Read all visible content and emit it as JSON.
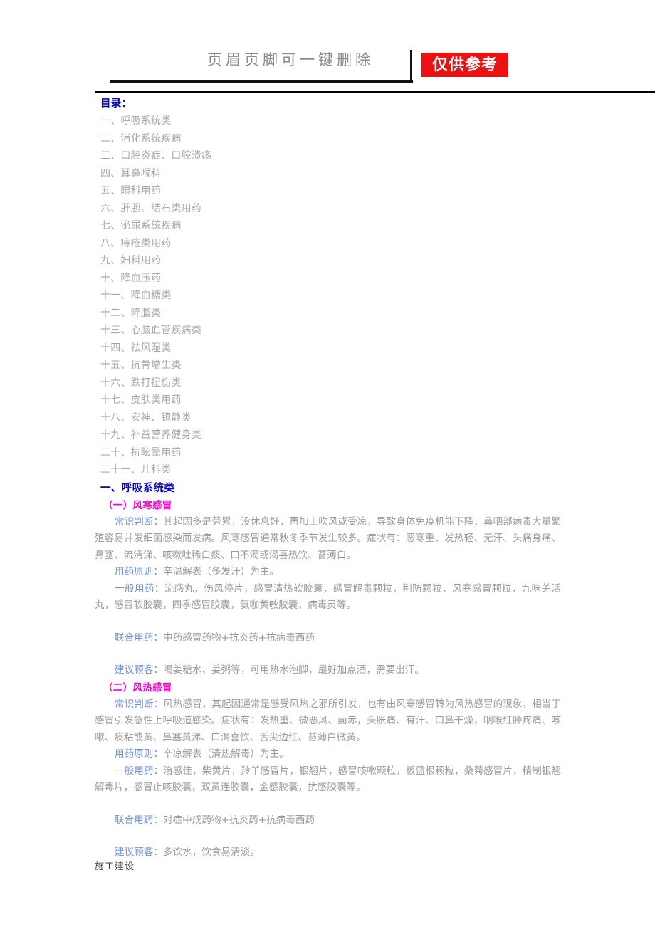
{
  "header": {
    "watermark_text": "页眉页脚可一键删除",
    "badge_text": "仅供参考",
    "badge_color": "#ee1111"
  },
  "toc": {
    "title": "目录：",
    "items": [
      "一、呼吸系统类",
      "二、消化系统疾病",
      "三、口腔炎症、口腔溃疡",
      "四、耳鼻喉科",
      "五、眼科用药",
      "六、肝胆、结石类用药",
      "七、泌尿系统疾病",
      "八、痔疮类用药",
      "九、妇科用药",
      "十、降血压药",
      "十一、降血糖类",
      "十二、降脂类",
      "十三、心脑血管疾病类",
      "十四、祛风湿类",
      "十五、抗骨增生类",
      "十六、跌打扭伤类",
      "十七、皮肤类用药",
      "十八、安神、镇静类",
      "十九、补益营养健身类",
      "二十、抗眩晕用药",
      "二十一、儿科类"
    ]
  },
  "section": {
    "title": "一、呼吸系统类",
    "title_color": "#0000cc",
    "subsections": [
      {
        "title": "（一）风寒感冒",
        "title_color": "#ff00cc",
        "paragraphs": [
          {
            "label": "常识判断：",
            "text": "其起因多是劳累，没休息好，再加上吹风或受凉，导致身体免疫机能下降，鼻咽部病毒大量繁殖容易并发细菌感染而发病。风寒感冒通常秋冬季节发生较多。症状有：恶寒重、发热轻、无汗、头痛身痛、鼻塞、流清涕、咳嗽吐稀白痰、口不渴或渴喜热饮、苔薄白。",
            "gap": false
          },
          {
            "label": "用药原则：",
            "text": "辛温解表（多发汗）为主。",
            "gap": false
          },
          {
            "label": "一般用药：",
            "text": "流感丸，伤风停片，感冒清热软胶囊，感冒解毒颗粒，荆防颗粒，风寒感冒颗粒，九味羌活丸，感冒软胶囊，四季感冒胶囊，氨咖黄敏胶囊，病毒灵等。",
            "gap": false
          },
          {
            "label": "联合用药：",
            "text": "中药感冒药物+抗炎药+抗病毒西药",
            "gap": true
          },
          {
            "label": "建议顾客：",
            "text": "喝姜糖水、姜粥等，可用热水泡脚，最好加点酒，需要出汗。",
            "gap": true
          }
        ]
      },
      {
        "title": "（二）风热感冒",
        "title_color": "#ff00cc",
        "paragraphs": [
          {
            "label": "常识判断：",
            "text": "风热感冒，其起因通常是感受风热之邪所引发，也有由风寒感冒转为风热感冒的现象，相当于感冒引发急性上呼吸道感染。症状有：发热重、微恶风、面赤，头胀痛、有汗、口鼻干燥，咽喉红肿疼痛、咳嗽、痰粘或黄、鼻塞黄涕、口渴喜饮、舌尖边红、苔薄白微黄。",
            "gap": false
          },
          {
            "label": "用药原则：",
            "text": "辛凉解表（清热解毒）为主。",
            "gap": false
          },
          {
            "label": "一般用药：",
            "text": "治感佳，柴黄片，羚羊感冒片，银翘片，感冒咳嗽颗粒，板蓝根颗粒，桑菊感冒片，精制银翘解毒片，感冒止咳胶囊，双黄连胶囊，金感胶囊，抗感胶囊等。",
            "gap": false
          },
          {
            "label": "联合用药：",
            "text": "对症中成药物+抗炎药+抗病毒西药",
            "gap": true
          },
          {
            "label": "建议顾客：",
            "text": "多饮水，饮食易清淡。",
            "gap": true
          }
        ]
      }
    ]
  },
  "footer": {
    "text": "施工建设"
  }
}
